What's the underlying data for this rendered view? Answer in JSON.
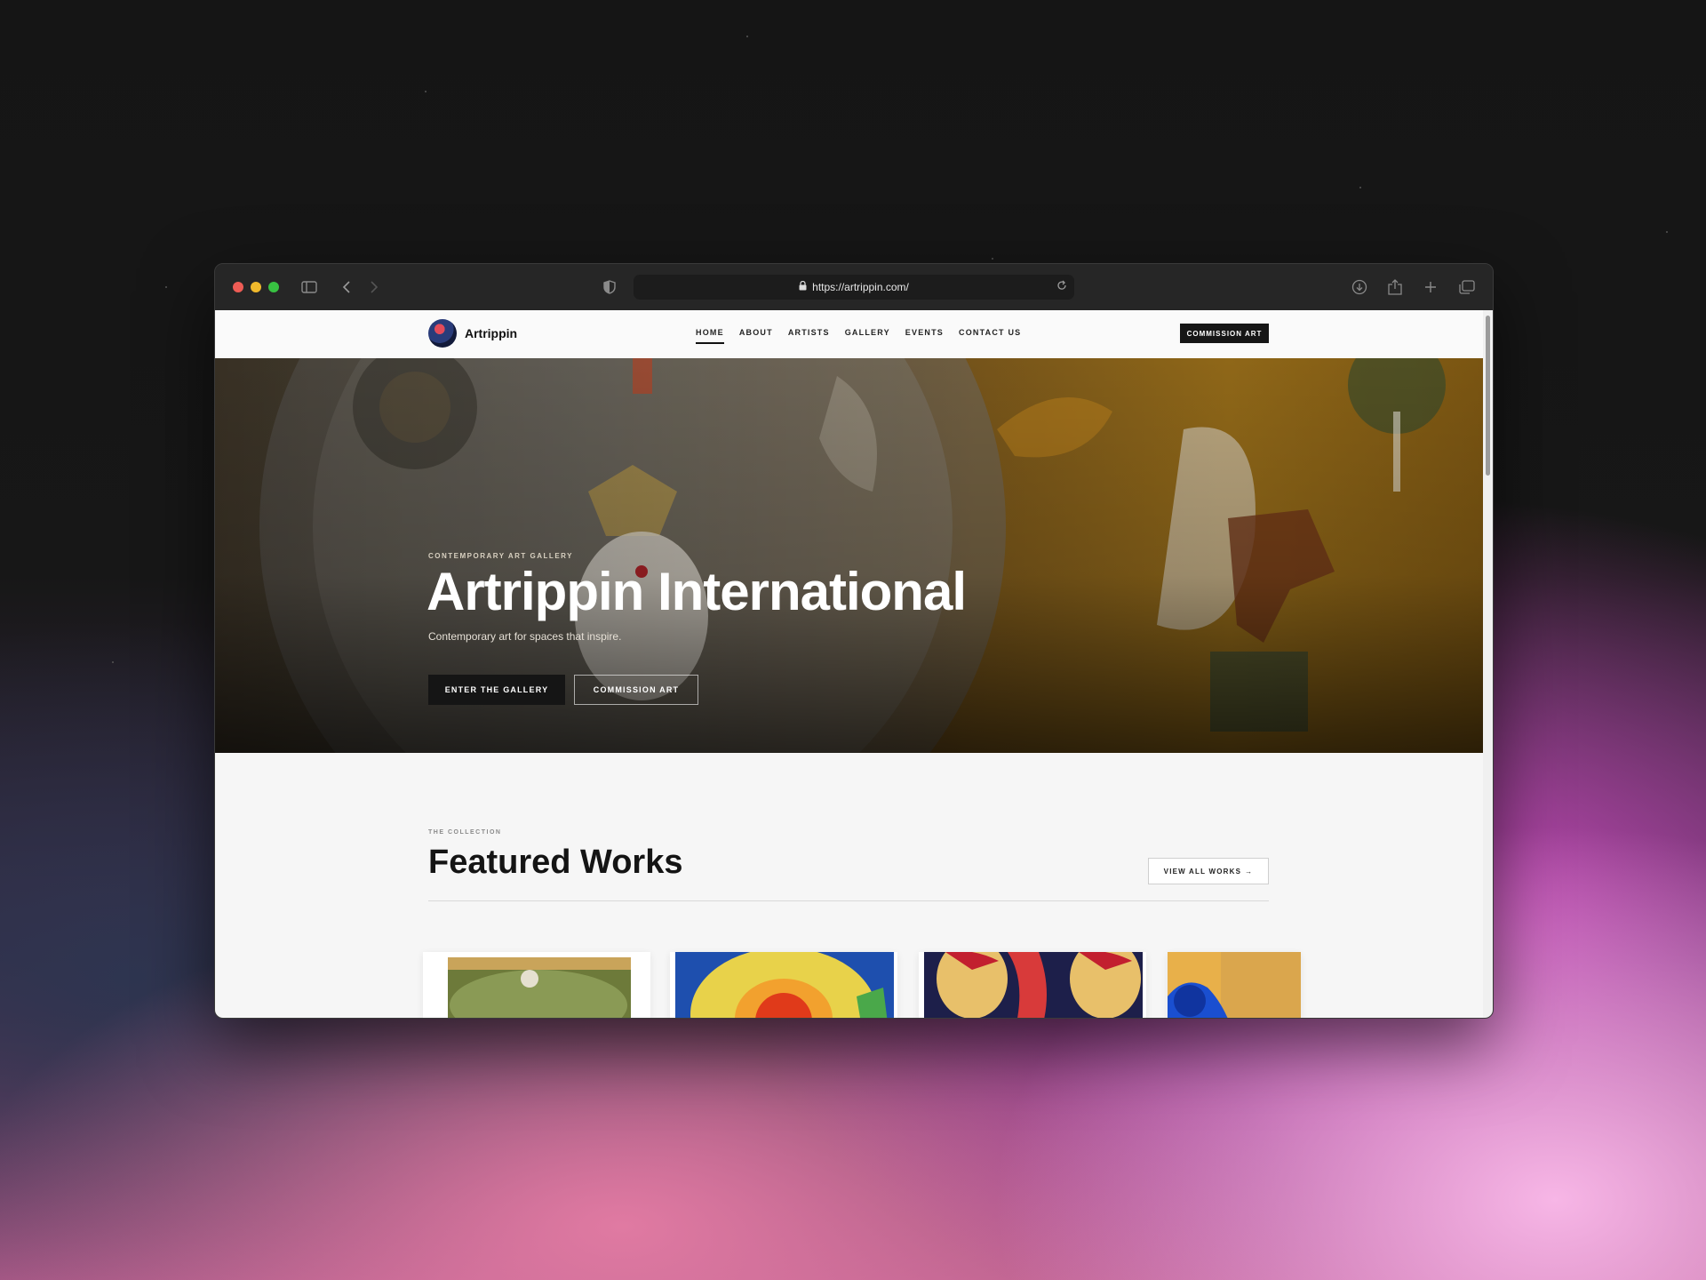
{
  "browser": {
    "url": "https://artrippin.com/",
    "icons": [
      "sidebar-icon",
      "back-icon",
      "forward-icon",
      "shield-icon",
      "lock-icon",
      "reload-icon",
      "download-icon",
      "share-icon",
      "new-tab-icon",
      "tabs-icon"
    ]
  },
  "nav": {
    "brand": "Artrippin",
    "items": [
      "HOME",
      "ABOUT",
      "ARTISTS",
      "GALLERY",
      "EVENTS",
      "CONTACT US"
    ],
    "active": "HOME",
    "cta": "COMMISSION ART"
  },
  "hero": {
    "eyebrow": "CONTEMPORARY ART GALLERY",
    "title": "Artrippin International",
    "subtitle": "Contemporary art for spaces that inspire.",
    "primary_button": "ENTER THE GALLERY",
    "secondary_button": "COMMISSION ART"
  },
  "featured": {
    "eyebrow": "THE COLLECTION",
    "title": "Featured Works",
    "view_all": "VIEW ALL WORKS",
    "view_all_arrow": "→"
  },
  "colors": {
    "accent": "#161616",
    "hero_gold": "#8f6718"
  }
}
